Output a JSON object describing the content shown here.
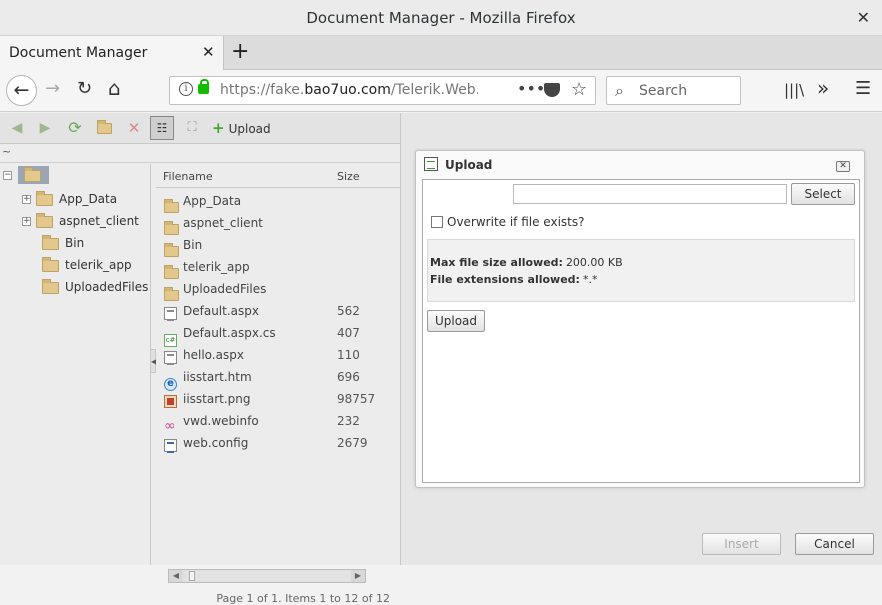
{
  "window": {
    "title": "Document Manager - Mozilla Firefox",
    "close_glyph": "✕"
  },
  "tab": {
    "label": "Document Manager",
    "close_glyph": "✕",
    "new_tab_glyph": "+"
  },
  "nav": {
    "back_glyph": "←",
    "forward_glyph": "→",
    "reload_glyph": "↻",
    "home_glyph": "⌂",
    "url_prefix": "https://fake.",
    "url_domain": "bao7uo.com",
    "url_path": "/Telerik.Web.UI",
    "page_actions_glyph": "•••",
    "bookmark_glyph": "☆",
    "search_placeholder": "Search",
    "search_glyph": "⌕",
    "library_glyph": "|||\\",
    "overflow_glyph": "»",
    "menu_glyph": "☰"
  },
  "toolbar": {
    "upload_label": "Upload",
    "upload_glyph": "+"
  },
  "path": "~",
  "tree": [
    {
      "label": "App_Data",
      "expandable": true
    },
    {
      "label": "aspnet_client",
      "expandable": true
    },
    {
      "label": "Bin",
      "expandable": false
    },
    {
      "label": "telerik_app",
      "expandable": false
    },
    {
      "label": "UploadedFiles",
      "expandable": false
    }
  ],
  "grid": {
    "columns": {
      "filename": "Filename",
      "size": "Size"
    },
    "rows": [
      {
        "name": "App_Data",
        "size": "",
        "type": "folder"
      },
      {
        "name": "aspnet_client",
        "size": "",
        "type": "folder"
      },
      {
        "name": "Bin",
        "size": "",
        "type": "folder"
      },
      {
        "name": "telerik_app",
        "size": "",
        "type": "folder"
      },
      {
        "name": "UploadedFiles",
        "size": "",
        "type": "folder"
      },
      {
        "name": "Default.aspx",
        "size": "562",
        "type": "aspx"
      },
      {
        "name": "Default.aspx.cs",
        "size": "407",
        "type": "cs"
      },
      {
        "name": "hello.aspx",
        "size": "110",
        "type": "aspx"
      },
      {
        "name": "iisstart.htm",
        "size": "696",
        "type": "htm"
      },
      {
        "name": "iisstart.png",
        "size": "98757",
        "type": "png"
      },
      {
        "name": "vwd.webinfo",
        "size": "232",
        "type": "web"
      },
      {
        "name": "web.config",
        "size": "2679",
        "type": "cfg"
      }
    ],
    "pager": "Page 1 of 1. Items 1 to 12 of 12"
  },
  "upload": {
    "title": "Upload",
    "select_label": "Select",
    "overwrite_label": "Overwrite if file exists?",
    "max_size_label": "Max file size allowed:",
    "max_size_value": "200.00 KB",
    "ext_label": "File extensions allowed:",
    "ext_value": "*.*",
    "upload_label": "Upload",
    "close_glyph": "✕"
  },
  "footer": {
    "insert_label": "Insert",
    "cancel_label": "Cancel"
  }
}
